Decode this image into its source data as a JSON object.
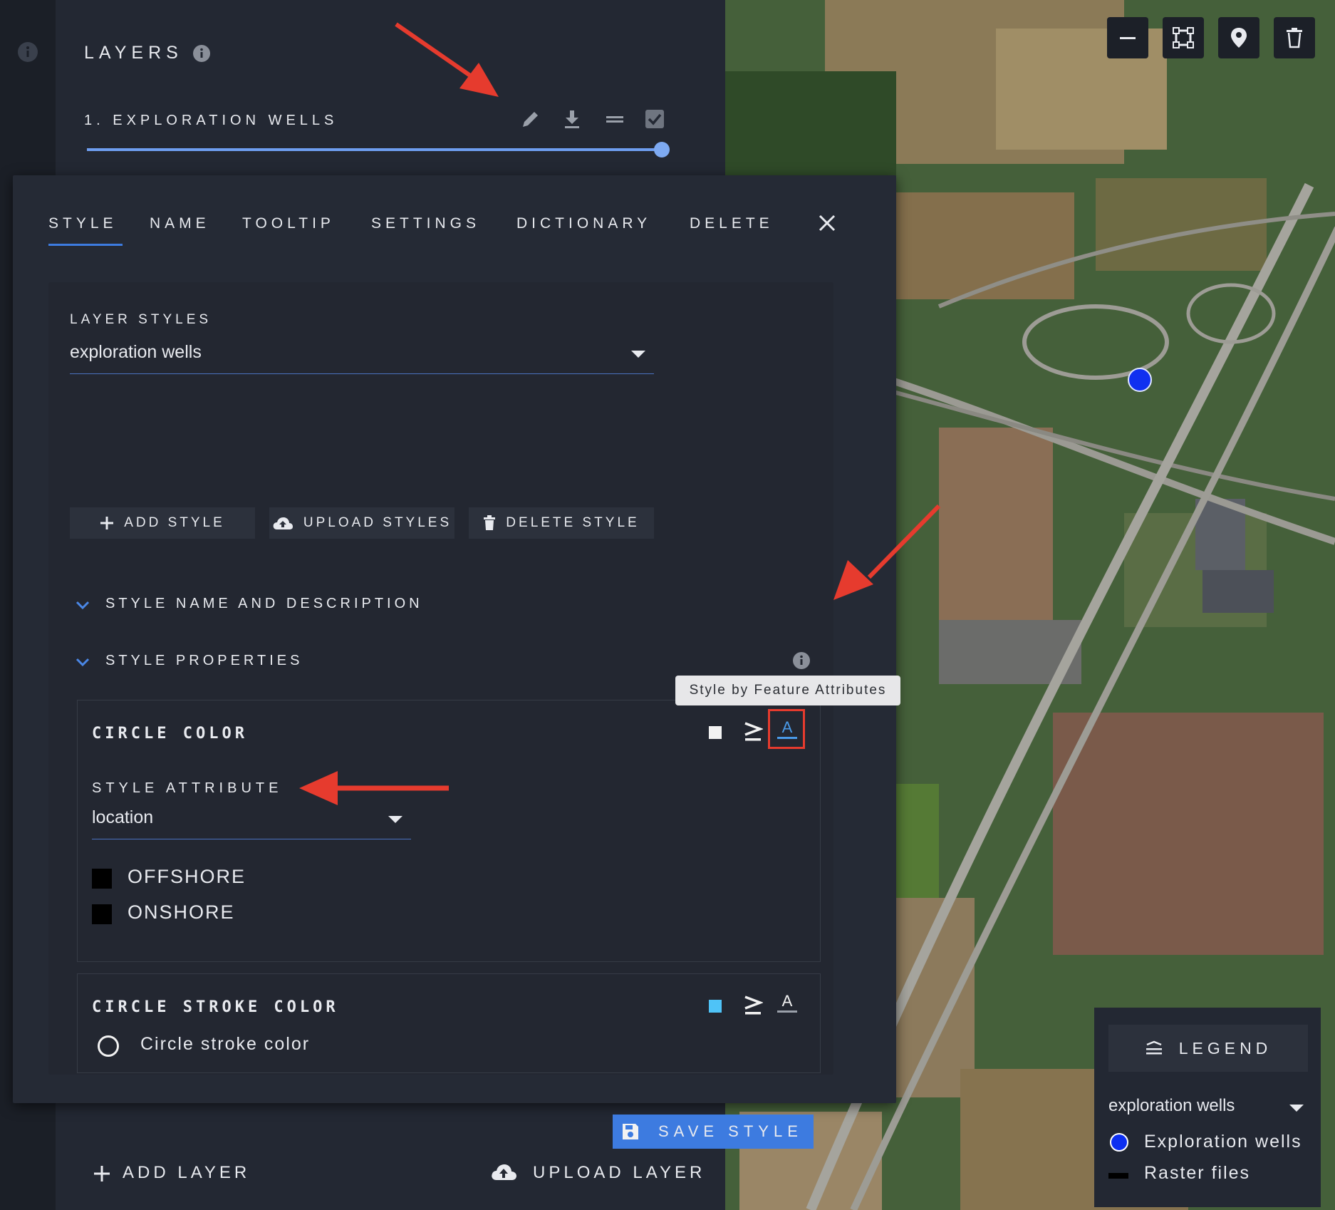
{
  "layers_panel": {
    "title": "LAYERS",
    "layer_name": "1. EXPLORATION WELLS",
    "opacity": 1.0,
    "add_layer_label": "ADD LAYER",
    "upload_layer_label": "UPLOAD LAYER"
  },
  "modal": {
    "tabs": [
      {
        "label": "STYLE",
        "active": true
      },
      {
        "label": "NAME"
      },
      {
        "label": "TOOLTIP"
      },
      {
        "label": "SETTINGS"
      },
      {
        "label": "DICTIONARY"
      },
      {
        "label": "DELETE"
      }
    ],
    "layer_styles_label": "LAYER STYLES",
    "selected_style": "exploration wells",
    "add_style_label": "ADD STYLE",
    "upload_styles_label": "UPLOAD STYLES",
    "delete_style_label": "DELETE STYLE",
    "section_name_desc": "STYLE NAME AND DESCRIPTION",
    "section_properties": "STYLE PROPERTIES",
    "circle_color": {
      "title": "CIRCLE COLOR",
      "attribute_label": "STYLE ATTRIBUTE",
      "attribute_value": "location",
      "categories": [
        {
          "label": "OFFSHORE",
          "color": "#000000"
        },
        {
          "label": "ONSHORE",
          "color": "#000000"
        }
      ]
    },
    "tooltip": "Style by Feature Attributes",
    "circle_stroke": {
      "title": "CIRCLE STROKE COLOR",
      "label": "Circle stroke color",
      "swatch_color": "#4fc3f7"
    },
    "save_label": "SAVE STYLE"
  },
  "legend": {
    "title": "LEGEND",
    "selected": "exploration wells",
    "items": [
      {
        "label": "Exploration wells",
        "color": "#0d2ff0"
      },
      {
        "label": "Raster files",
        "color": "#000000"
      }
    ]
  },
  "colors": {
    "accent": "#3d7be0",
    "annotation": "#e63b2e",
    "well_point": "#1030f0"
  }
}
